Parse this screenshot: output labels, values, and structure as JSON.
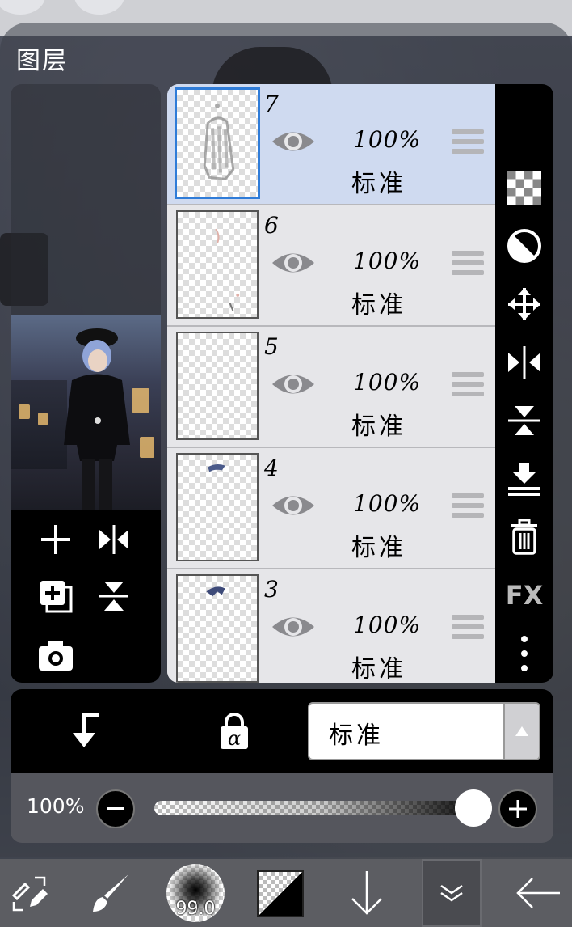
{
  "panel": {
    "title": "图层"
  },
  "layers": [
    {
      "number": "7",
      "opacity": "100%",
      "blend": "标准",
      "selected": true
    },
    {
      "number": "6",
      "opacity": "100%",
      "blend": "标准",
      "selected": false
    },
    {
      "number": "5",
      "opacity": "100%",
      "blend": "标准",
      "selected": false
    },
    {
      "number": "4",
      "opacity": "100%",
      "blend": "标准",
      "selected": false
    },
    {
      "number": "3",
      "opacity": "100%",
      "blend": "标准",
      "selected": false
    }
  ],
  "right_tools": [
    "checker-icon",
    "half-circle-icon",
    "move-icon",
    "flip-horizontal-icon",
    "flip-vertical-icon",
    "merge-down-icon",
    "trash-icon",
    "fx-icon",
    "more-icon"
  ],
  "right_tool_labels": {
    "fx": "FX"
  },
  "left_tools": [
    "add-layer-icon",
    "flip-horizontal-icon",
    "duplicate-layer-icon",
    "flip-vertical-icon",
    "camera-icon"
  ],
  "blend_mode": {
    "value": "标准"
  },
  "opacity": {
    "label": "100%",
    "value": 1.0
  },
  "toolbar": {
    "brush_size": "99.0"
  },
  "colors": {
    "selected_layer_bg": "#cfdaf0",
    "selection_border": "#2f7cd8",
    "panel_black": "#000000",
    "toolbar_bg": "#5c5d62"
  }
}
